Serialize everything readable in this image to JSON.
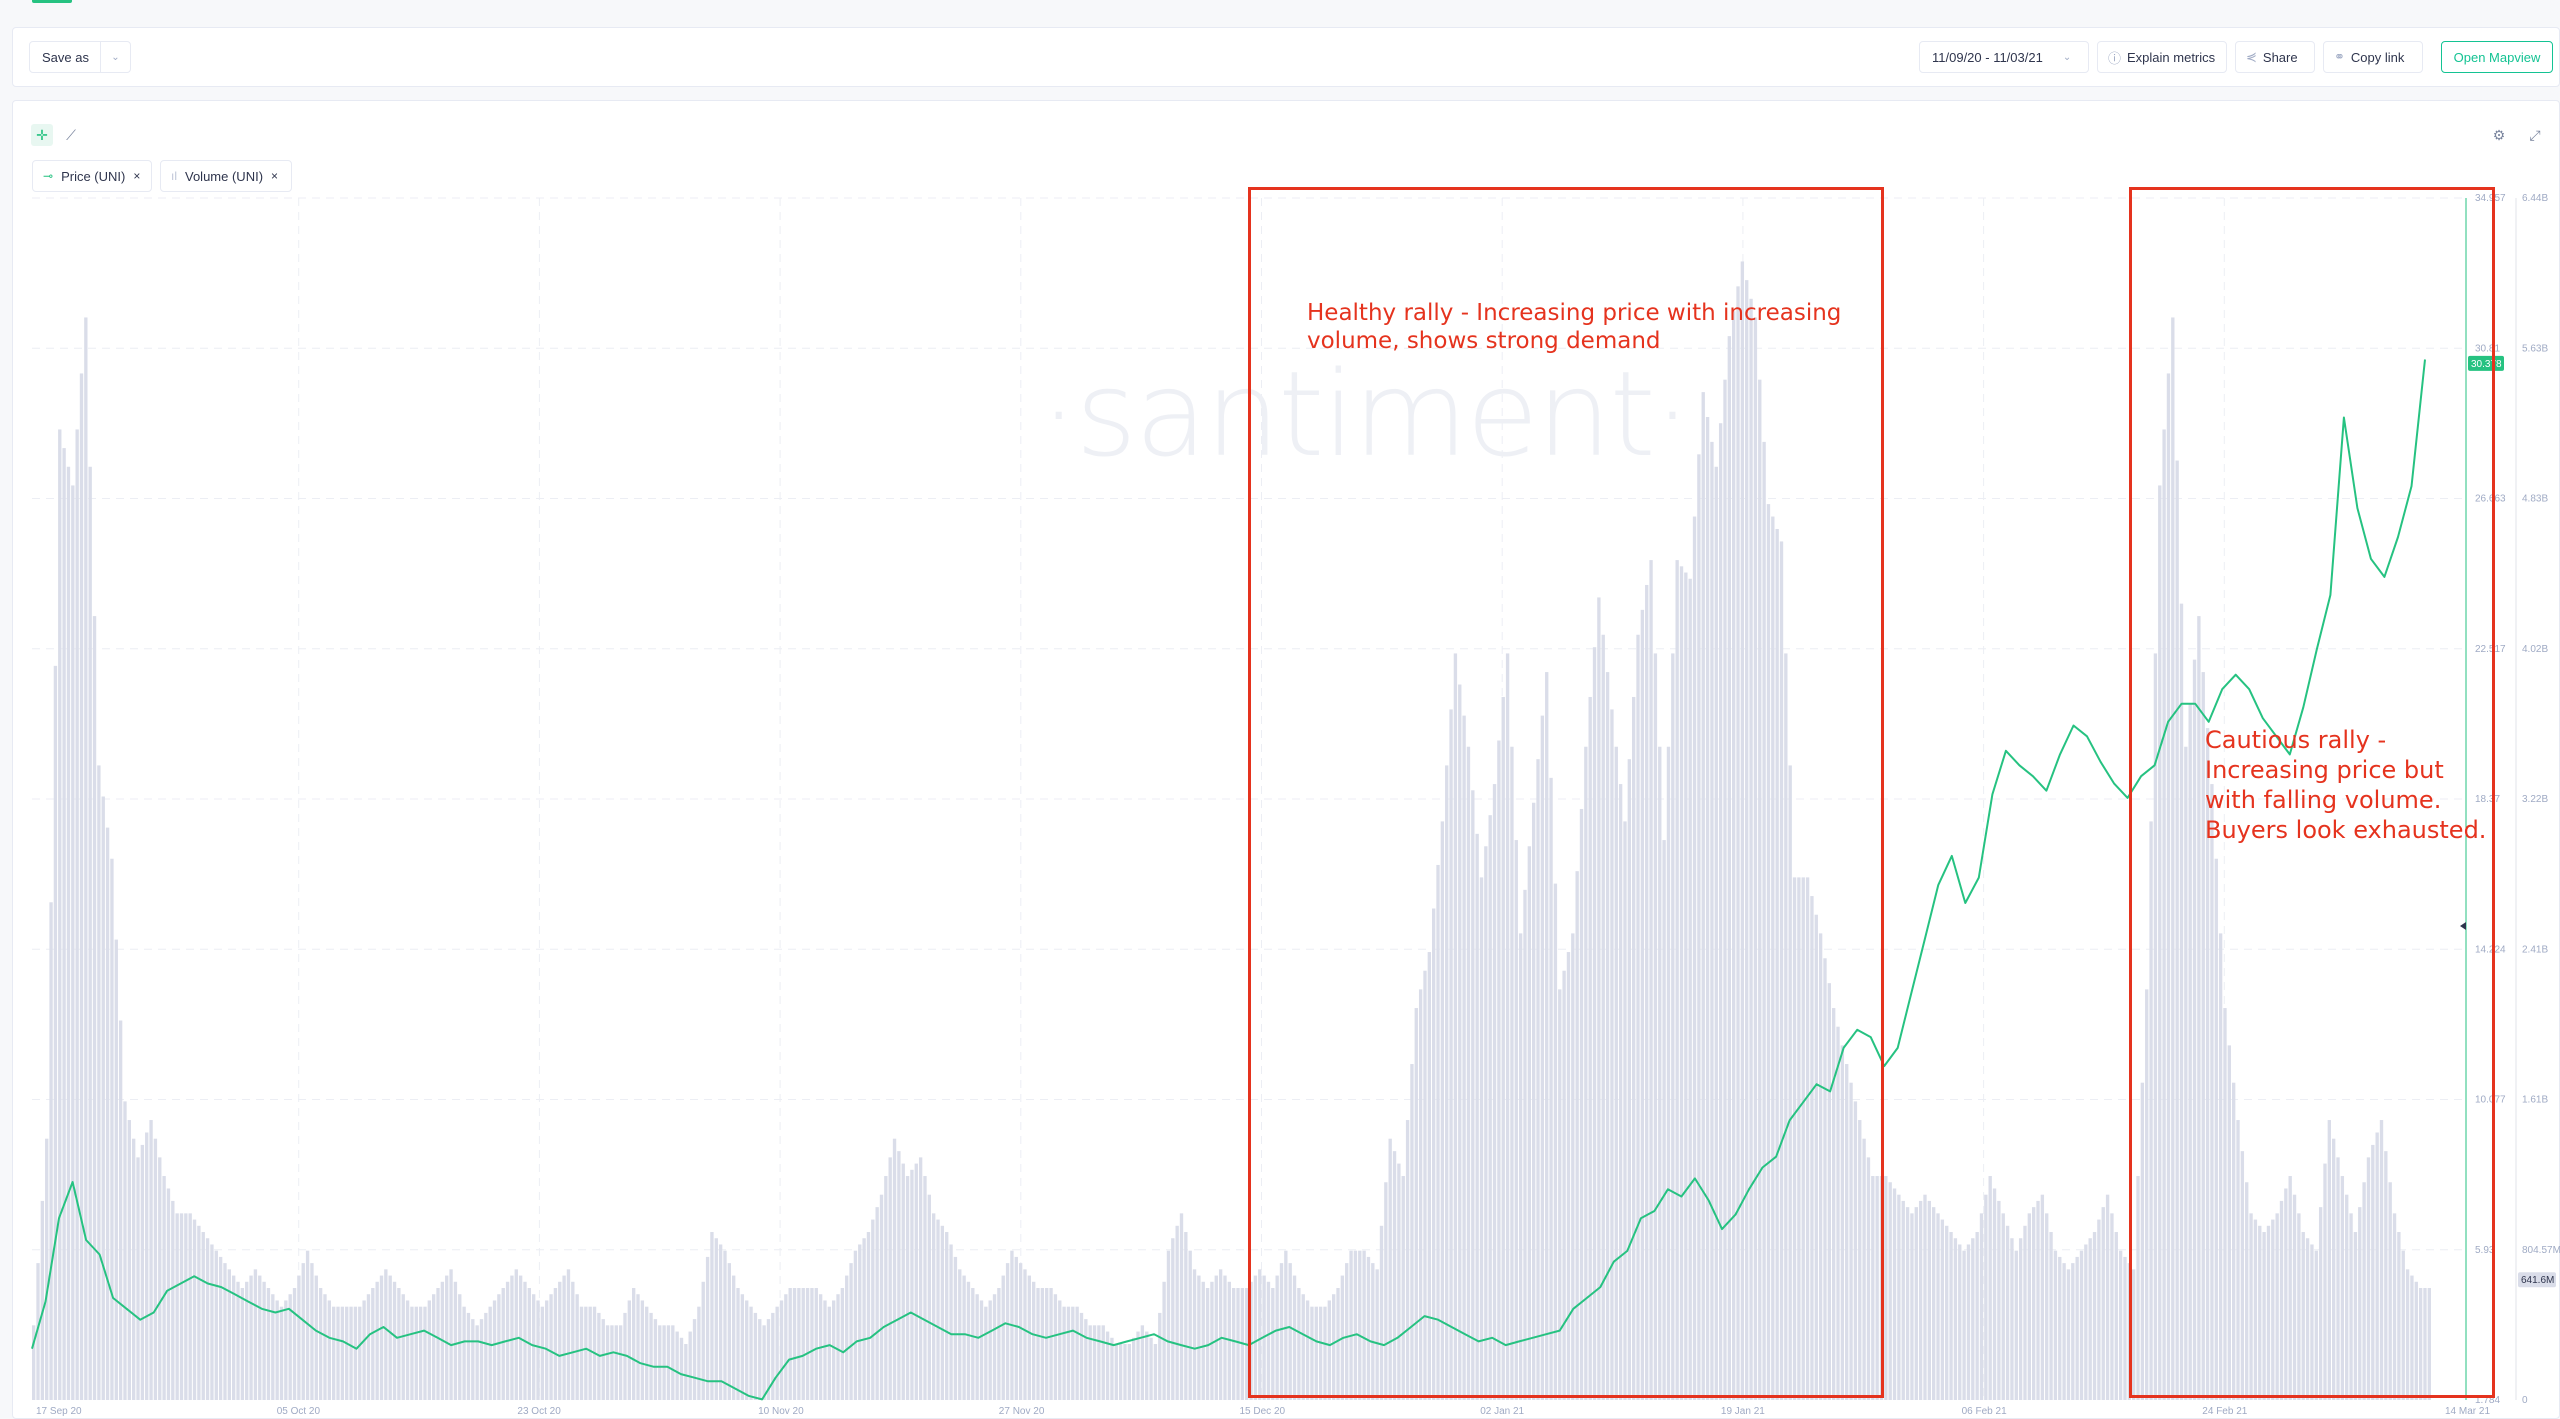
{
  "toolbar": {
    "save_as_label": "Save as",
    "save_as_chevron": "⌄",
    "date_range": "11/09/20 - 11/03/21",
    "explain_metrics_label": "Explain metrics",
    "share_label": "Share",
    "copy_link_label": "Copy link",
    "open_mapview_label": "Open Mapview"
  },
  "icons": {
    "crosshair": "✛",
    "draw_line": "⟋",
    "settings": "⚙",
    "fullscreen": "⤢",
    "info": "ⓘ",
    "share": "⋞",
    "link": "🔗",
    "chevron": "⌄",
    "close": "×",
    "price_marker": "⊸",
    "volume_marker": "ıl"
  },
  "metrics": [
    {
      "label": "Price (UNI)",
      "close": "×"
    },
    {
      "label": "Volume (UNI)",
      "close": "×"
    }
  ],
  "watermark": "·santiment·",
  "annotations": [
    {
      "text": "Healthy rally - Increasing price with increasing volume, shows strong demand"
    },
    {
      "text": "Cautious rally - Increasing price but with falling volume. Buyers look exhausted."
    }
  ],
  "colors": {
    "price_line": "#26c281",
    "volume_bars": "#dadde9",
    "annotation": "#e5331e",
    "accent": "#14c393",
    "current_volume_badge": "#dadde9"
  },
  "chart_data": {
    "type": "line+bar",
    "title": "",
    "xlabel": "",
    "ylabel": "",
    "x_tick_labels": [
      "17 Sep 20",
      "05 Oct 20",
      "23 Oct 20",
      "10 Nov 20",
      "27 Nov 20",
      "15 Dec 20",
      "02 Jan 21",
      "19 Jan 21",
      "06 Feb 21",
      "24 Feb 21",
      "14 Mar 21"
    ],
    "price_axis": {
      "ticks": [
        "34.957",
        "30.81",
        "26.663",
        "22.517",
        "18.37",
        "14.224",
        "10.077",
        "5.93",
        "1.784"
      ],
      "range": [
        1.784,
        34.957
      ],
      "current_value": "30.378"
    },
    "volume_axis": {
      "ticks": [
        "6.44B",
        "5.63B",
        "4.83B",
        "4.02B",
        "3.22B",
        "2.41B",
        "1.61B",
        "804.57M",
        "0"
      ],
      "range": [
        0,
        6.44
      ],
      "unit": "B",
      "current_value": "641.6M"
    },
    "grid": true,
    "legend": "top-left",
    "series": [
      {
        "name": "Price (UNI)",
        "type": "line",
        "x_days_from_start": [
          0,
          1,
          2,
          3,
          4,
          5,
          6,
          7,
          8,
          9,
          10,
          11,
          12,
          13,
          14,
          15,
          16,
          17,
          18,
          19,
          20,
          21,
          22,
          23,
          24,
          25,
          26,
          27,
          28,
          29,
          30,
          31,
          32,
          33,
          34,
          35,
          36,
          37,
          38,
          39,
          40,
          41,
          42,
          43,
          44,
          45,
          46,
          47,
          48,
          49,
          50,
          51,
          52,
          53,
          54,
          55,
          56,
          57,
          58,
          59,
          60,
          61,
          62,
          63,
          64,
          65,
          66,
          67,
          68,
          69,
          70,
          71,
          72,
          73,
          74,
          75,
          76,
          77,
          78,
          79,
          80,
          81,
          82,
          83,
          84,
          85,
          86,
          87,
          88,
          89,
          90,
          91,
          92,
          93,
          94,
          95,
          96,
          97,
          98,
          99,
          100,
          101,
          102,
          103,
          104,
          105,
          106,
          107,
          108,
          109,
          110,
          111,
          112,
          113,
          114,
          115,
          116,
          117,
          118,
          119,
          120,
          121,
          122,
          123,
          124,
          125,
          126,
          127,
          128,
          129,
          130,
          131,
          132,
          133,
          134,
          135,
          136,
          137,
          138,
          139,
          140,
          141,
          142,
          143,
          144,
          145,
          146,
          147,
          148,
          149,
          150,
          151,
          152,
          153,
          154,
          155,
          156,
          157,
          158,
          159,
          160,
          161,
          162,
          163,
          164,
          165,
          166,
          167,
          168,
          169,
          170,
          171,
          172,
          173,
          174
        ],
        "values": [
          3.2,
          4.5,
          6.8,
          7.8,
          6.2,
          5.8,
          4.6,
          4.3,
          4.0,
          4.2,
          4.8,
          5.0,
          5.2,
          5.0,
          4.9,
          4.7,
          4.5,
          4.3,
          4.2,
          4.3,
          4.0,
          3.7,
          3.5,
          3.4,
          3.2,
          3.6,
          3.8,
          3.5,
          3.6,
          3.7,
          3.5,
          3.3,
          3.4,
          3.4,
          3.3,
          3.4,
          3.5,
          3.3,
          3.2,
          3.0,
          3.1,
          3.2,
          3.0,
          3.1,
          3.0,
          2.8,
          2.7,
          2.7,
          2.5,
          2.4,
          2.3,
          2.3,
          2.1,
          1.9,
          1.8,
          2.4,
          2.9,
          3.0,
          3.2,
          3.3,
          3.1,
          3.4,
          3.5,
          3.8,
          4.0,
          4.2,
          4.0,
          3.8,
          3.6,
          3.6,
          3.5,
          3.7,
          3.9,
          3.8,
          3.6,
          3.5,
          3.6,
          3.7,
          3.5,
          3.4,
          3.3,
          3.4,
          3.5,
          3.6,
          3.4,
          3.3,
          3.2,
          3.3,
          3.5,
          3.4,
          3.3,
          3.5,
          3.7,
          3.8,
          3.6,
          3.4,
          3.3,
          3.5,
          3.6,
          3.4,
          3.3,
          3.5,
          3.8,
          4.1,
          4.0,
          3.8,
          3.6,
          3.4,
          3.5,
          3.3,
          3.4,
          3.5,
          3.6,
          3.7,
          4.3,
          4.6,
          4.9,
          5.6,
          5.9,
          6.8,
          7.0,
          7.6,
          7.4,
          7.9,
          7.3,
          6.5,
          6.9,
          7.6,
          8.2,
          8.5,
          9.5,
          10.0,
          10.5,
          10.3,
          11.5,
          12.0,
          11.8,
          11.0,
          11.5,
          13.0,
          14.5,
          16.0,
          16.8,
          15.5,
          16.2,
          18.5,
          19.7,
          19.3,
          19.0,
          18.6,
          19.6,
          20.4,
          20.1,
          19.4,
          18.8,
          18.4,
          19.0,
          19.3,
          20.5,
          21.0,
          21.0,
          20.5,
          21.4,
          21.8,
          21.4,
          20.6,
          20.1,
          19.6,
          20.9,
          22.5,
          24.0,
          28.9,
          26.4,
          25.0,
          24.5,
          25.6,
          27.0,
          30.5
        ],
        "note": "approximate, sampled from the plotted line; final values continue 26.0-33.8 before ending near 30.378"
      },
      {
        "name": "Volume (UNI)",
        "type": "bar",
        "unit": "B",
        "values": [
          0.4,
          1.4,
          5.2,
          4.9,
          5.8,
          3.4,
          2.9,
          1.6,
          1.3,
          1.5,
          1.2,
          1.0,
          1.0,
          0.9,
          0.8,
          0.7,
          0.6,
          0.7,
          0.6,
          0.5,
          0.6,
          0.8,
          0.6,
          0.5,
          0.5,
          0.5,
          0.6,
          0.7,
          0.6,
          0.5,
          0.5,
          0.6,
          0.7,
          0.5,
          0.4,
          0.5,
          0.6,
          0.7,
          0.6,
          0.5,
          0.6,
          0.7,
          0.5,
          0.5,
          0.4,
          0.4,
          0.6,
          0.5,
          0.4,
          0.4,
          0.3,
          0.5,
          0.9,
          0.8,
          0.6,
          0.5,
          0.4,
          0.5,
          0.6,
          0.6,
          0.6,
          0.5,
          0.6,
          0.8,
          0.9,
          1.1,
          1.4,
          1.2,
          1.3,
          1.0,
          0.9,
          0.7,
          0.6,
          0.5,
          0.6,
          0.8,
          0.7,
          0.6,
          0.6,
          0.5,
          0.5,
          0.4,
          0.4,
          0.3,
          0.3,
          0.4,
          0.3,
          0.8,
          1.0,
          0.7,
          0.6,
          0.7,
          0.6,
          0.6,
          0.7,
          0.6,
          0.8,
          0.6,
          0.5,
          0.5,
          0.6,
          0.8,
          0.8,
          0.7,
          1.4,
          1.2,
          2.1,
          2.4,
          3.1,
          4.0,
          3.5,
          2.8,
          3.3,
          4.0,
          2.5,
          3.2,
          3.9,
          2.2,
          2.5,
          3.5,
          4.3,
          3.7,
          3.1,
          4.1,
          4.5,
          3.0,
          4.5,
          4.4,
          5.4,
          5.0,
          5.7,
          6.1,
          5.8,
          4.8,
          4.6,
          2.8,
          2.8,
          2.5,
          2.1,
          1.8,
          1.5,
          1.2,
          1.2,
          1.1,
          1.0,
          1.1,
          1.0,
          0.9,
          0.8,
          0.9,
          1.2,
          1.0,
          0.8,
          1.0,
          1.1,
          0.8,
          0.7,
          0.8,
          0.9,
          1.1,
          0.8,
          0.7,
          2.2,
          4.9,
          5.8,
          3.5,
          4.2,
          3.3,
          2.1,
          1.5,
          1.0,
          0.9,
          1.0,
          1.2,
          0.9,
          0.8,
          1.5,
          1.2,
          0.9,
          1.3,
          1.5,
          1.0,
          0.7,
          0.6
        ],
        "note": "approximate, sampled from the bar heights"
      }
    ]
  }
}
